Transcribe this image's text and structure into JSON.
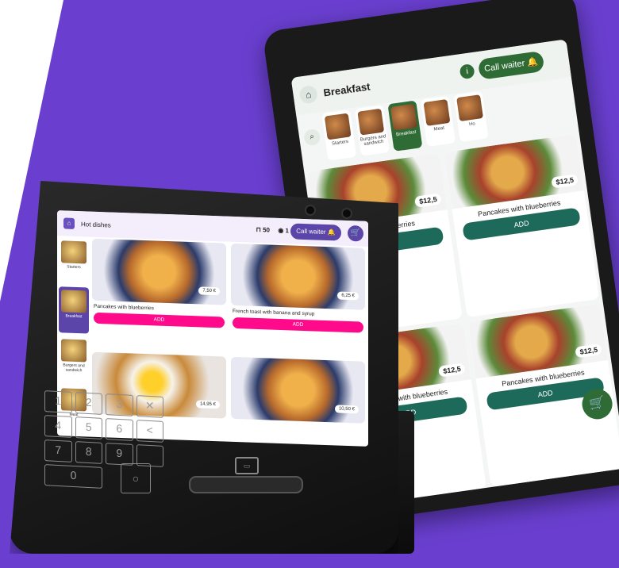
{
  "colors": {
    "background_purple": "#6a3fd0",
    "kiosk_accent_purple": "#5b45a8",
    "kiosk_add_pink": "#ff0a8a",
    "tablet_accent_green": "#2f6b35",
    "tablet_add_teal": "#1e6a5a"
  },
  "tablet_right": {
    "header": {
      "title": "Breakfast",
      "info_icon": "info-icon",
      "call_label": "Call waiter",
      "bell_icon": "bell-icon",
      "home_icon": "home-icon"
    },
    "search_icon": "search-icon",
    "categories": [
      {
        "label": "Starters"
      },
      {
        "label": "Burgers and sandwich"
      },
      {
        "label": "Breakfast"
      },
      {
        "label": "Meat"
      },
      {
        "label": "Ho"
      }
    ],
    "active_category": "Breakfast",
    "items": [
      {
        "name": "...es with blueberries",
        "price": "$12,5",
        "add": "ADD"
      },
      {
        "name": "Pancakes with blueberries",
        "price": "$12,5",
        "add": "ADD"
      },
      {
        "name": "Pancakes with blueberries",
        "price": "$12,5",
        "add": "ADD"
      },
      {
        "name": "Pancakes with blueberries",
        "price": "$12,5",
        "add": "ADD"
      }
    ],
    "cart_icon": "cart-icon"
  },
  "kiosk_left": {
    "header": {
      "title": "Hot dishes",
      "covers": "50",
      "people": "1",
      "call_label": "Call waiter",
      "home_icon": "home-icon",
      "cart_icon": "cart-icon"
    },
    "categories": [
      {
        "label": "Starters"
      },
      {
        "label": "Breakfast"
      },
      {
        "label": "Burgers and sandwich"
      },
      {
        "label": "Meat"
      }
    ],
    "active_category": "Breakfast",
    "items": [
      {
        "name": "Pancakes with blueberries",
        "price": "7,50 €",
        "add": "ADD"
      },
      {
        "name": "French toast with banana and syrup",
        "price": "6,25 €",
        "add": "ADD"
      },
      {
        "name": "",
        "price": "14,95 €",
        "add": ""
      },
      {
        "name": "",
        "price": "10,50 €",
        "add": ""
      }
    ],
    "keypad": [
      "1",
      "2",
      "3",
      "✕",
      "4",
      "5",
      "6",
      "<",
      "7",
      "8",
      "9",
      "",
      "0",
      "○"
    ],
    "card_reader_icon": "card-reader-icon"
  }
}
